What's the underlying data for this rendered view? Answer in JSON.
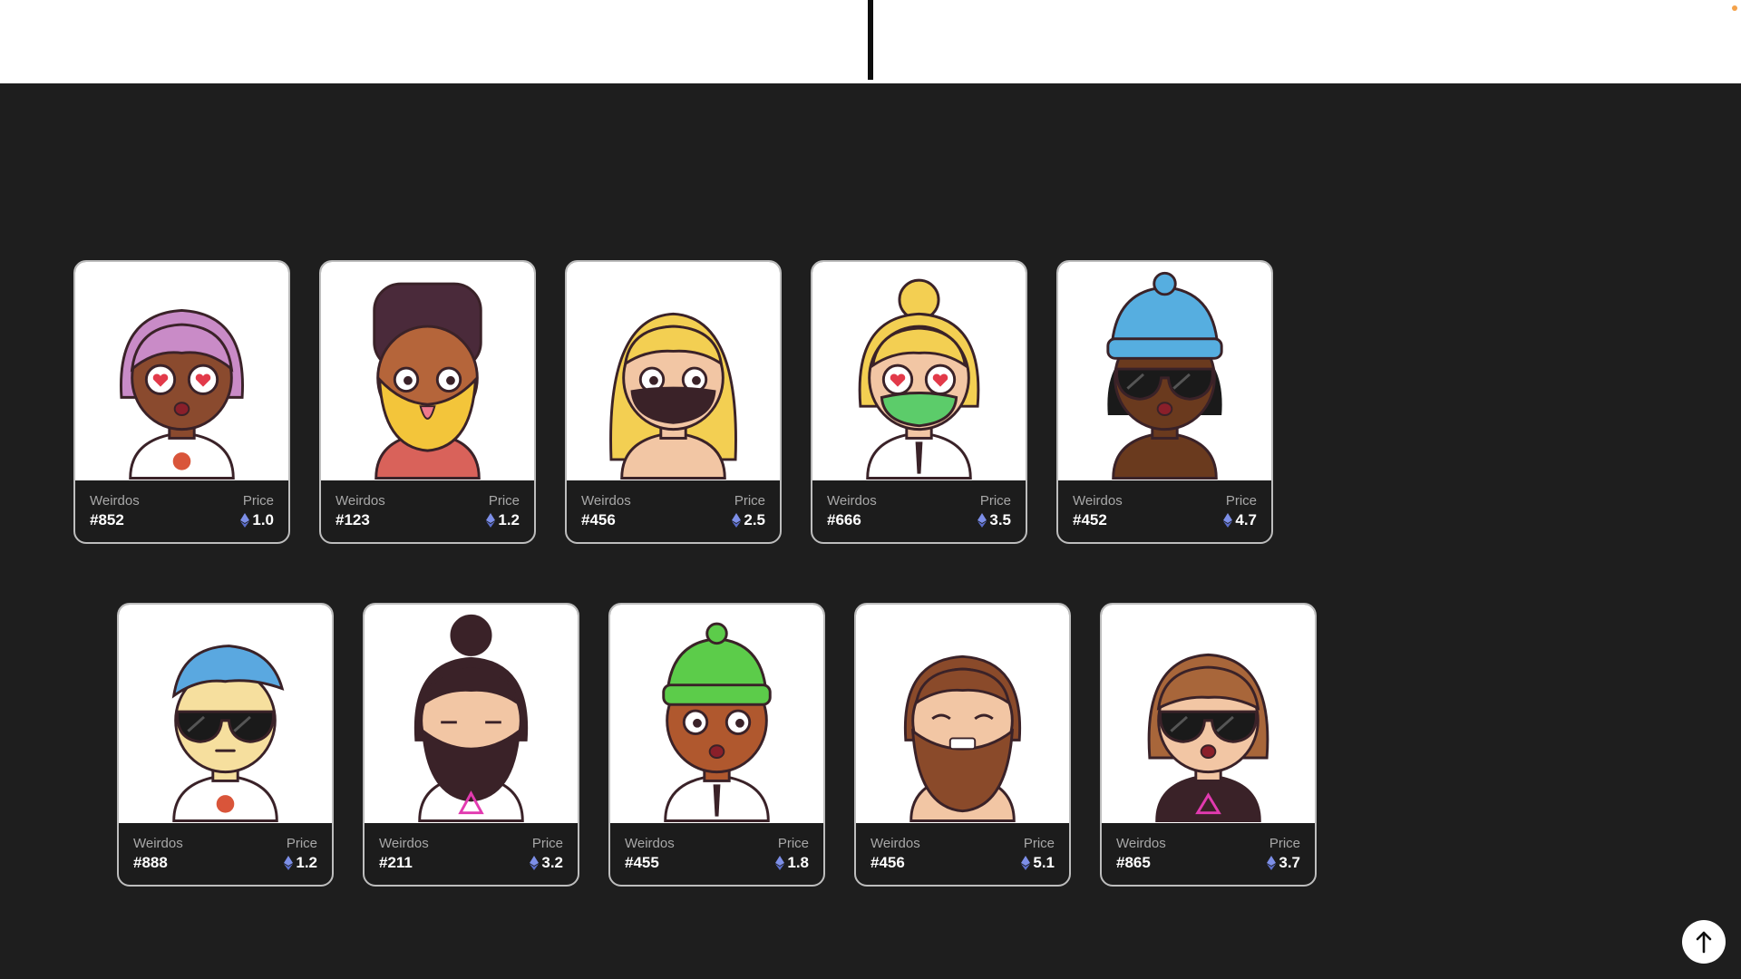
{
  "cards_row1": [
    {
      "collection": "Weirdos",
      "id": "#852",
      "price_label": "Price",
      "price": "1.0",
      "hair": "#c98bc7",
      "skin": "#8a4a2e",
      "shirt": "#ffffff",
      "acc": "heart-glasses"
    },
    {
      "collection": "Weirdos",
      "id": "#123",
      "price_label": "Price",
      "price": "1.2",
      "hair": "#4a2a3a",
      "skin": "#b5653a",
      "shirt": "#d9625a",
      "acc": "turban-beard"
    },
    {
      "collection": "Weirdos",
      "id": "#456",
      "price_label": "Price",
      "price": "2.5",
      "hair": "#f3cf52",
      "skin": "#f2c6a4",
      "shirt": "#f2c6a4",
      "acc": "mask"
    },
    {
      "collection": "Weirdos",
      "id": "#666",
      "price_label": "Price",
      "price": "3.5",
      "hair": "#f3cf52",
      "skin": "#f2c6a4",
      "shirt": "#ffffff",
      "acc": "green-mask"
    },
    {
      "collection": "Weirdos",
      "id": "#452",
      "price_label": "Price",
      "price": "4.7",
      "hair": "#56aee0",
      "skin": "#6a3a1e",
      "shirt": "#6a3a1e",
      "acc": "beanie-sunglasses"
    }
  ],
  "cards_row2": [
    {
      "collection": "Weirdos",
      "id": "#888",
      "price_label": "Price",
      "price": "1.2",
      "hair": "#5aa8e0",
      "skin": "#f6df9e",
      "shirt": "#ffffff",
      "acc": "sunglasses"
    },
    {
      "collection": "Weirdos",
      "id": "#211",
      "price_label": "Price",
      "price": "3.2",
      "hair": "#3a2228",
      "skin": "#f2c6a4",
      "shirt": "#ffffff",
      "acc": "bun-beard"
    },
    {
      "collection": "Weirdos",
      "id": "#455",
      "price_label": "Price",
      "price": "1.8",
      "hair": "#5ccc4a",
      "skin": "#b0582e",
      "shirt": "#ffffff",
      "acc": "green-beanie"
    },
    {
      "collection": "Weirdos",
      "id": "#456",
      "price_label": "Price",
      "price": "5.1",
      "hair": "#8a4a2a",
      "skin": "#f2c6a4",
      "shirt": "#f2c6a4",
      "acc": "long-beard"
    },
    {
      "collection": "Weirdos",
      "id": "#865",
      "price_label": "Price",
      "price": "3.7",
      "hair": "#a8663a",
      "skin": "#f2c6a4",
      "shirt": "#3a2228",
      "acc": "bob-sunglasses"
    }
  ],
  "scroll_top": {
    "icon": "arrow-up-icon"
  },
  "colors": {
    "background": "#1e1e1e",
    "card_footer": "#1c1c1c",
    "card_border": "#bdbdbd",
    "eth": "#7d8fe8"
  }
}
